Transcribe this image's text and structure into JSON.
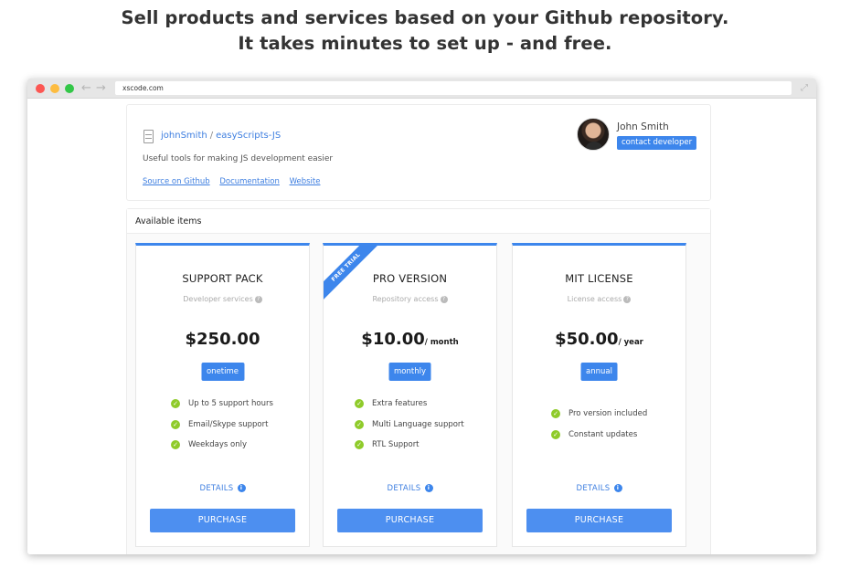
{
  "headline": {
    "line1": "Sell products and services based on your Github repository.",
    "line2": "It takes minutes to set up - and free."
  },
  "browser": {
    "url": "xscode.com",
    "back_glyph": "←",
    "forward_glyph": "→",
    "expand_glyph": "⤢"
  },
  "repo": {
    "owner": "johnSmith",
    "separator": "/",
    "name": "easyScripts-JS",
    "description": "Useful tools for making JS development easier",
    "links": [
      "Source on Github",
      "Documentation",
      "Website"
    ]
  },
  "developer": {
    "name": "John Smith",
    "contact_label": "contact developer"
  },
  "items": {
    "header": "Available items",
    "cards": [
      {
        "title": "SUPPORT PACK",
        "subtitle": "Developer services",
        "price": "$250.00",
        "period": "",
        "billing": "onetime",
        "features": [
          "Up to 5 support hours",
          "Email/Skype support",
          "Weekdays only"
        ],
        "details": "DETAILS",
        "purchase": "PURCHASE"
      },
      {
        "title": "PRO VERSION",
        "subtitle": "Repository access",
        "price": "$10.00",
        "period": "/ month",
        "billing": "monthly",
        "ribbon": "FREE TRIAL",
        "features": [
          "Extra features",
          "Multi Language support",
          "RTL Support"
        ],
        "details": "DETAILS",
        "purchase": "PURCHASE"
      },
      {
        "title": "MIT LICENSE",
        "subtitle": "License access",
        "price": "$50.00",
        "period": "/ year",
        "billing": "annual",
        "features": [
          "Pro version included",
          "Constant updates"
        ],
        "details": "DETAILS",
        "purchase": "PURCHASE"
      }
    ]
  },
  "icons": {
    "help": "?",
    "check": "✓",
    "info": "i"
  },
  "colors": {
    "accent": "#3d86ec",
    "link": "#3d7ee0",
    "check": "#8fcb2a"
  }
}
